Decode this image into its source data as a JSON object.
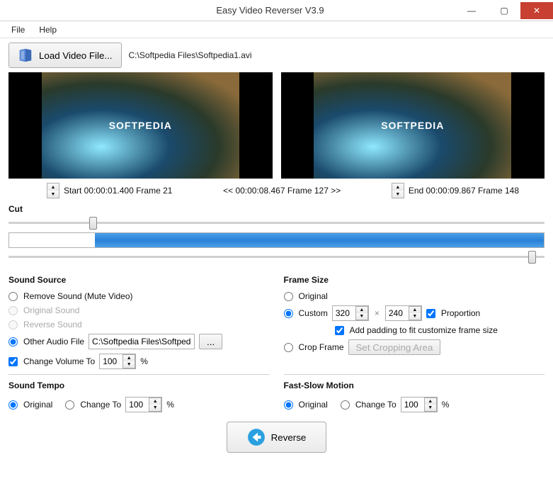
{
  "window": {
    "title": "Easy Video Reverser V3.9"
  },
  "menu": {
    "file": "File",
    "help": "Help"
  },
  "toolbar": {
    "load_label": "Load Video File...",
    "file_path": "C:\\Softpedia Files\\Softpedia1.avi"
  },
  "preview": {
    "left_text": "SOFTPEDIA",
    "right_text": "SOFTPEDIA"
  },
  "timeline": {
    "start_label": "Start 00:00:01.400  Frame 21",
    "middle_label": "<<  00:00:08.467   Frame 127  >>",
    "end_label": "End 00:00:09.867  Frame 148"
  },
  "cut": {
    "label": "Cut",
    "start_pct": 15,
    "end_pct": 97,
    "progress_white_pct": 16
  },
  "sound_source": {
    "title": "Sound Source",
    "remove": "Remove Sound (Mute Video)",
    "original": "Original Sound",
    "reverse": "Reverse Sound",
    "other": "Other Audio File",
    "other_path": "C:\\Softpedia Files\\Softpedia",
    "browse": "...",
    "change_volume": "Change Volume To",
    "volume_value": "100",
    "volume_unit": "%"
  },
  "sound_tempo": {
    "title": "Sound Tempo",
    "original": "Original",
    "change_to": "Change To",
    "value": "100",
    "unit": "%"
  },
  "frame_size": {
    "title": "Frame Size",
    "original": "Original",
    "custom": "Custom",
    "width": "320",
    "height": "240",
    "proportion": "Proportion",
    "padding": "Add padding to fit customize frame size",
    "crop": "Crop Frame",
    "set_crop": "Set Cropping Area"
  },
  "motion": {
    "title": "Fast-Slow Motion",
    "original": "Original",
    "change_to": "Change To",
    "value": "100",
    "unit": "%"
  },
  "reverse": {
    "label": "Reverse"
  }
}
